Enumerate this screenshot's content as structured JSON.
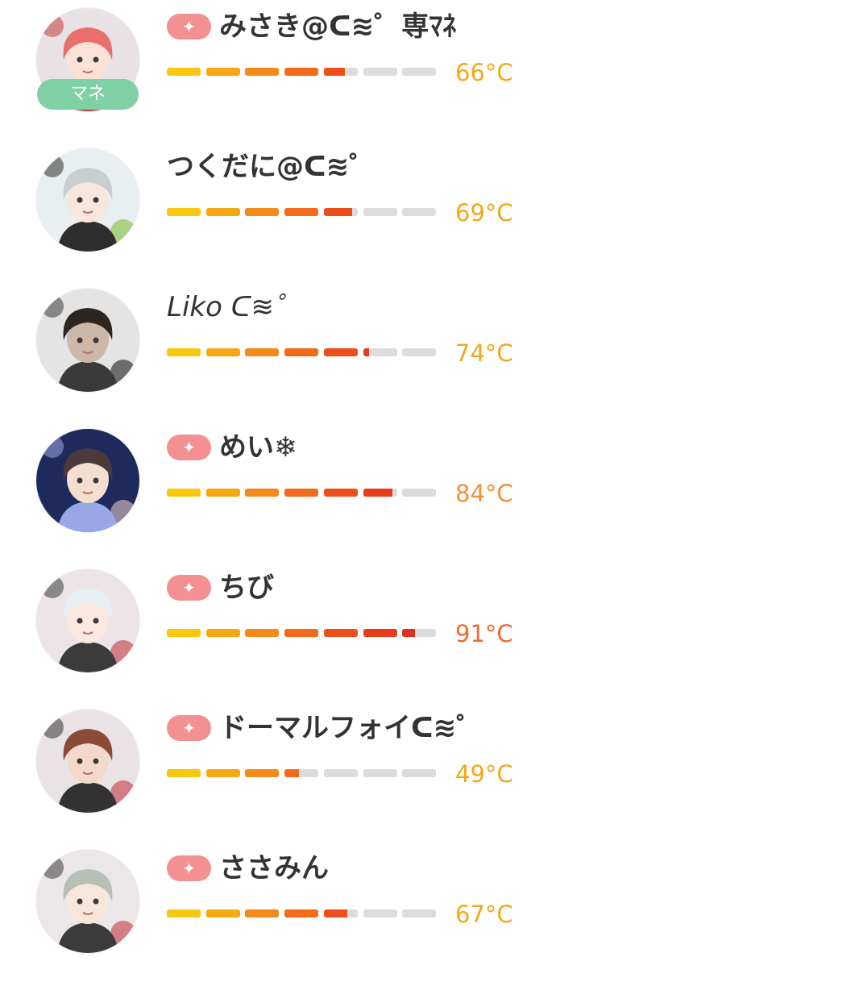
{
  "colors": {
    "badge": "#f39091",
    "role_badge": "#7fd1a3",
    "bar_empty": "#dcdcdc",
    "segment_fills": [
      "#f9c70f",
      "#f6a813",
      "#f48a1a",
      "#f26a1c",
      "#ec4f1b",
      "#e43d1c",
      "#dc2f1c"
    ],
    "temp_colors": {
      "low": "#f3a818",
      "mid": "#f39131",
      "high": "#ee6b2a"
    }
  },
  "members": [
    {
      "name": "みさき@ᑕ≋゜専ﾏﾈ",
      "has_badge": true,
      "badge_icon": "sparkle-icon",
      "role": "マネ",
      "level": 0.66,
      "temperature": "66°C",
      "temp_color": "#f3a818",
      "avatar_icon": "anime-avatar-red-hair"
    },
    {
      "name": "つくだに@ᑕ≋゜",
      "has_badge": false,
      "role": "",
      "level": 0.69,
      "temperature": "69°C",
      "temp_color": "#f3a818",
      "avatar_icon": "anime-avatar-green-hat"
    },
    {
      "name": "Liko ᑕ≋゜",
      "has_badge": false,
      "role": "",
      "level": 0.74,
      "temperature": "74°C",
      "temp_color": "#f3a818",
      "avatar_icon": "photo-avatar-dark-hair"
    },
    {
      "name": "めい❄︎",
      "has_badge": true,
      "badge_icon": "sparkle-icon",
      "role": "",
      "level": 0.84,
      "temperature": "84°C",
      "temp_color": "#f39131",
      "avatar_icon": "anime-avatar-night-sky"
    },
    {
      "name": "ちび",
      "has_badge": true,
      "badge_icon": "sparkle-icon",
      "role": "",
      "level": 0.91,
      "temperature": "91°C",
      "temp_color": "#ee6b2a",
      "avatar_icon": "anime-avatar-white-hair"
    },
    {
      "name": "ドーマルフォイᑕ≋゜",
      "has_badge": true,
      "badge_icon": "sparkle-icon",
      "role": "",
      "level": 0.49,
      "temperature": "49°C",
      "temp_color": "#f3a818",
      "avatar_icon": "anime-avatar-brown-hair"
    },
    {
      "name": "ささみん",
      "has_badge": true,
      "badge_icon": "sparkle-icon",
      "role": "",
      "level": 0.67,
      "temperature": "67°C",
      "temp_color": "#f3a818",
      "avatar_icon": "anime-avatar-gray-hair"
    }
  ]
}
